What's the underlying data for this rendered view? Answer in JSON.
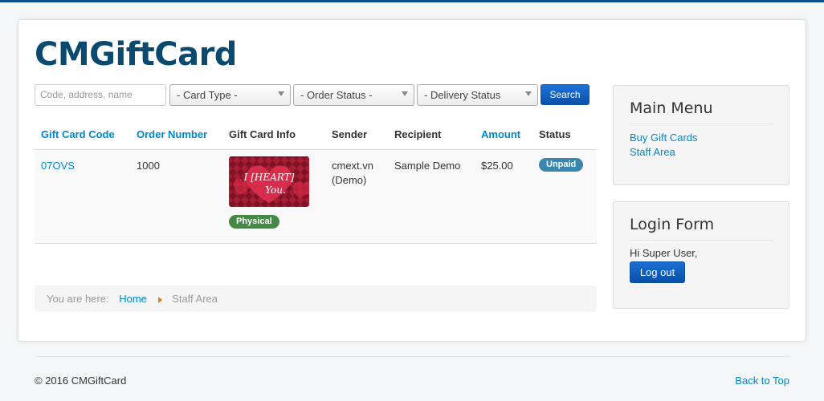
{
  "site": {
    "brand": "CMGiftCard"
  },
  "filters": {
    "search_placeholder": "Code, address, name",
    "card_type": "- Card Type -",
    "order_status": "- Order Status -",
    "delivery_status": "- Delivery Status",
    "search_label": "Search"
  },
  "table": {
    "headers": {
      "code": "Gift Card Code",
      "order": "Order Number",
      "info": "Gift Card Info",
      "sender": "Sender",
      "recipient": "Recipient",
      "amount": "Amount",
      "status": "Status"
    },
    "rows": [
      {
        "code": "07OVS",
        "order": "1000",
        "card_text": "I [HEART] You.",
        "type_badge": "Physical",
        "sender_line1": "cmext.vn",
        "sender_line2": "(Demo)",
        "recipient": "Sample Demo",
        "amount": "$25.00",
        "status": "Unpaid"
      }
    ]
  },
  "breadcrumb": {
    "prefix": "You are here:",
    "home": "Home",
    "current": "Staff Area"
  },
  "main_menu": {
    "title": "Main Menu",
    "items": [
      "Buy Gift Cards",
      "Staff Area"
    ]
  },
  "login_form": {
    "title": "Login Form",
    "greeting": "Hi Super User,",
    "logout_label": "Log out"
  },
  "footer": {
    "copyright": "© 2016 CMGiftCard",
    "back_to_top": "Back to Top"
  },
  "colors": {
    "accent": "#0088cc",
    "brand": "#0b4a6f",
    "success": "#468847",
    "info": "#3a87ad"
  }
}
